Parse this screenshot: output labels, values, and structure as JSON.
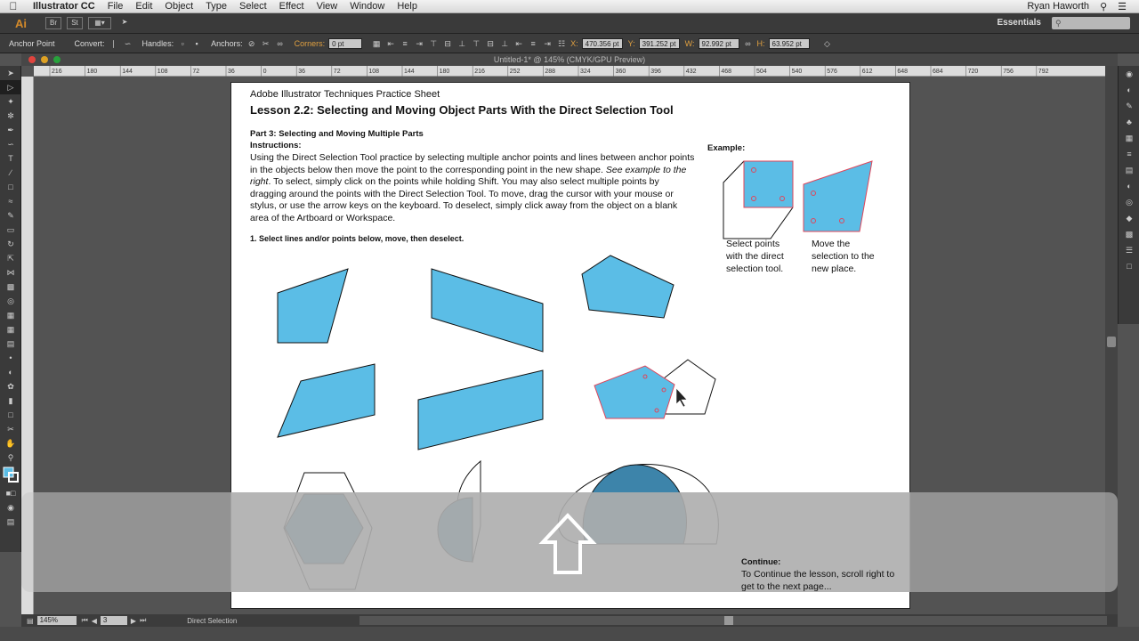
{
  "menubar": {
    "app_name": "Illustrator CC",
    "items": [
      "File",
      "Edit",
      "Object",
      "Type",
      "Select",
      "Effect",
      "View",
      "Window",
      "Help"
    ],
    "user": "Ryan Haworth"
  },
  "appbar": {
    "logo": "Ai",
    "workspace": "Essentials"
  },
  "control": {
    "tool_name": "Anchor Point",
    "convert_label": "Convert:",
    "handles_label": "Handles:",
    "anchors_label": "Anchors:",
    "corners_label": "Corners:",
    "corners_value": "0 pt",
    "x_label": "X:",
    "x_value": "470.356 pt",
    "y_label": "Y:",
    "y_value": "391.252 pt",
    "w_label": "W:",
    "w_value": "92.992 pt",
    "h_label": "H:",
    "h_value": "63.952 pt"
  },
  "document": {
    "title": "Untitled-1* @ 145% (CMYK/GPU Preview)",
    "ruler_marks": [
      "216",
      "180",
      "144",
      "108",
      "72",
      "36",
      "0",
      "36",
      "72",
      "108",
      "144",
      "180",
      "216",
      "252",
      "288",
      "324",
      "360",
      "396",
      "432",
      "468",
      "504",
      "540",
      "576",
      "612",
      "648",
      "684",
      "720",
      "756",
      "792"
    ]
  },
  "artboard": {
    "sheet_title": "Adobe Illustrator Techniques Practice Sheet",
    "lesson_title": "Lesson 2.2: Selecting and Moving Object Parts With the Direct Selection Tool",
    "part_title": "Part 3: Selecting and Moving Multiple Parts",
    "instructions_label": "Instructions:",
    "body_1": "Using the Direct Selection Tool practice by selecting multiple anchor points and lines between anchor points in the objects below then move the point to the corresponding point in the new shape. ",
    "body_italic": "See example to the right",
    "body_2": ". To select, simply click on the points while holding Shift. You may also select multiple points by dragging around the points with the Direct Selection Tool. To move, drag the cursor with your mouse or stylus, or use the arrow keys on the keyboard. To deselect, simply click away from the object on a blank area of the Artboard or Workspace.",
    "step_1": "1. Select lines and/or points below, move, then deselect.",
    "example_label": "Example:",
    "caption_1": "Select points with the direct selection tool.",
    "caption_2": "Move the selection to the new place.",
    "continue_title": "Continue:",
    "continue_body": "To Continue the lesson, scroll right to get to the next page..."
  },
  "status": {
    "zoom": "145%",
    "page": "3",
    "tool": "Direct Selection"
  },
  "colors": {
    "shape_fill": "#5bbde6",
    "shape_dark": "#3d84aa",
    "selection": "#e0455a",
    "panel_bg": "#3a3a3a",
    "accent_orange": "#d48a2a"
  }
}
